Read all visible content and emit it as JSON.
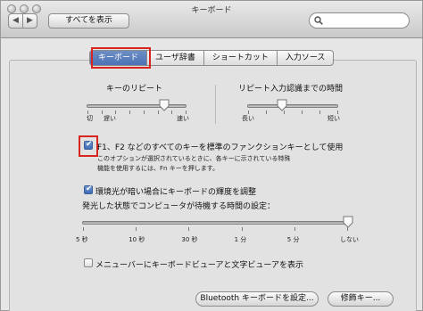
{
  "window": {
    "title": "キーボード"
  },
  "toolbar": {
    "back": "◀",
    "forward": "▶",
    "show_all": "すべてを表示",
    "search_placeholder": ""
  },
  "tabs": [
    "キーボード",
    "ユーザ辞書",
    "ショートカット",
    "入力ソース"
  ],
  "key_repeat": {
    "title": "キーのリピート",
    "left": "切",
    "slow": "遅い",
    "fast": "速い",
    "value": 0.78
  },
  "repeat_delay": {
    "title": "リピート入力認識までの時間",
    "long": "長い",
    "short": "短い",
    "value": 0.38
  },
  "fn_keys": {
    "label": "F1、F2 などのすべてのキーを標準のファンクションキーとして使用",
    "note1": "このオプションが選択されているときに、各キーに示されている特殊",
    "note2": "機能を使用するには、Fn キーを押します。",
    "checked": true
  },
  "illumination": {
    "label": "環境光が暗い場合にキーボードの輝度を調整",
    "checked": true
  },
  "idle": {
    "label": "発光した状態でコンピュータが待機する時間の設定：",
    "ticks": [
      "5 秒",
      "10 秒",
      "30 秒",
      "1 分",
      "5 分",
      "しない"
    ],
    "value": 1.0
  },
  "viewer": {
    "label": "メニューバーにキーボードビューアと文字ビューアを表示",
    "checked": false
  },
  "buttons": {
    "bluetooth": "Bluetooth キーボードを設定...",
    "modifier": "修飾キー..."
  }
}
